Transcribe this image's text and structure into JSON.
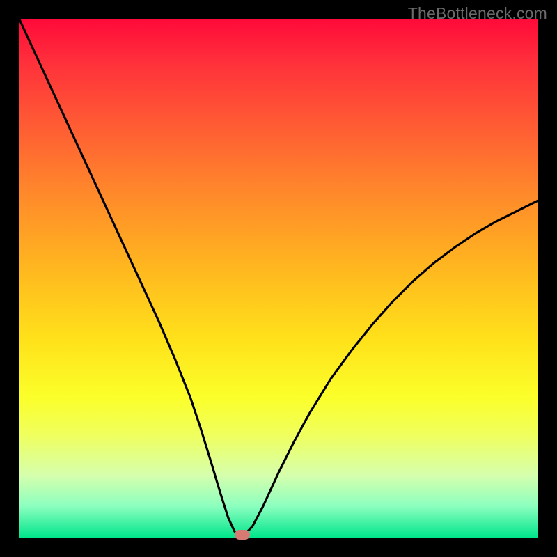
{
  "watermark": "TheBottleneck.com",
  "colors": {
    "frame": "#000000",
    "curve": "#000000",
    "marker": "#d77a74",
    "gradient_top": "#ff0a3a",
    "gradient_bottom": "#00e58b"
  },
  "chart_data": {
    "type": "line",
    "title": "",
    "xlabel": "",
    "ylabel": "",
    "xlim": [
      0,
      100
    ],
    "ylim": [
      0,
      100
    ],
    "x": [
      0,
      3,
      6,
      9,
      12,
      15,
      18,
      21,
      24,
      27,
      30,
      33,
      35,
      37,
      38.8,
      40.3,
      41.5,
      42.5,
      43.5,
      45,
      47,
      50,
      53,
      56,
      60,
      64,
      68,
      72,
      76,
      80,
      84,
      88,
      92,
      96,
      100
    ],
    "values": [
      100,
      93.5,
      87,
      80.5,
      74,
      67.5,
      61,
      54.5,
      48,
      41.5,
      34.5,
      27,
      21,
      14.5,
      8.5,
      3.8,
      1.2,
      0.6,
      0.6,
      2.2,
      6.0,
      12.5,
      18.5,
      24.0,
      30.5,
      36.0,
      41.0,
      45.5,
      49.5,
      53.0,
      56.0,
      58.7,
      61.0,
      63.0,
      65.0
    ],
    "marker": {
      "x": 43.0,
      "y": 0.6
    },
    "notes": "V-shaped bottleneck curve; minimum near x≈43 at y≈0.6. Axis values are normalized 0–100 estimates (no tick labels present in source)."
  }
}
